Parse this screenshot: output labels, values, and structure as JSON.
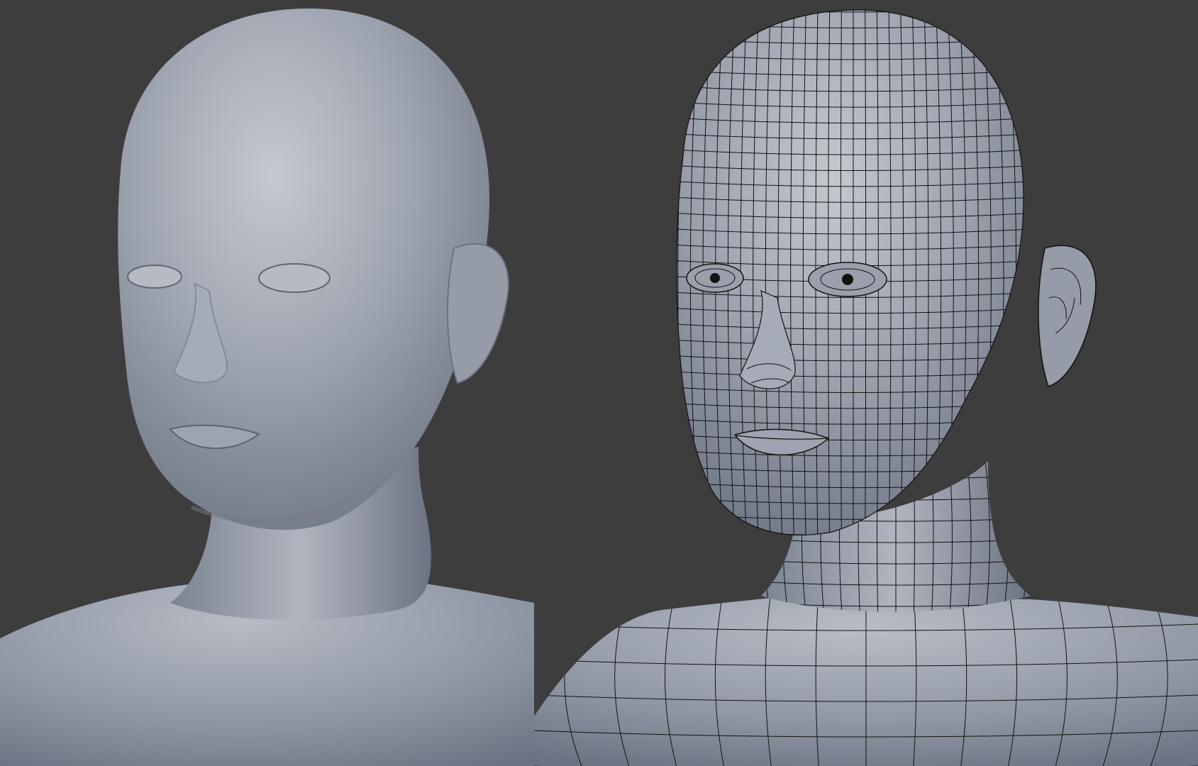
{
  "viewports": [
    {
      "id": "smooth-shaded-view",
      "shading": "solid",
      "wireframe": false
    },
    {
      "id": "wireframe-overlay-view",
      "shading": "solid",
      "wireframe": true
    }
  ],
  "colors": {
    "background": "#3d3d3d",
    "mesh_base": "#9ca2ad",
    "mesh_highlight": "#c9ccd2",
    "mesh_shadow": "#6f7686",
    "wire": "#111111"
  },
  "overlay": {
    "wire_lines_horizontal": 34,
    "wire_lines_vertical": 30
  }
}
